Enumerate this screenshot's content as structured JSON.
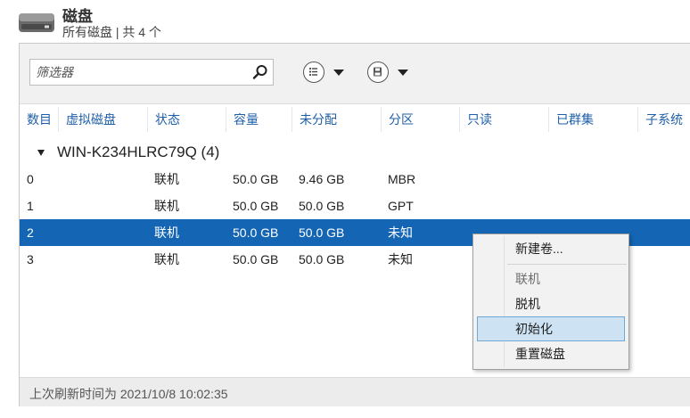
{
  "header": {
    "title": "磁盘",
    "subtitle": "所有磁盘 | 共 4 个"
  },
  "toolbar": {
    "filter_placeholder": "筛选器",
    "icons": [
      "search-icon",
      "list-view-icon",
      "save-icon"
    ]
  },
  "columns": [
    "数目",
    "虚拟磁盘",
    "状态",
    "容量",
    "未分配",
    "分区",
    "只读",
    "已群集",
    "子系统"
  ],
  "group": {
    "label": "WIN-K234HLRC79Q (4)"
  },
  "rows": [
    {
      "number": "0",
      "virtual": "",
      "status": "联机",
      "capacity": "50.0 GB",
      "unallocated": "9.46 GB",
      "partition": "MBR",
      "selected": false
    },
    {
      "number": "1",
      "virtual": "",
      "status": "联机",
      "capacity": "50.0 GB",
      "unallocated": "50.0 GB",
      "partition": "GPT",
      "selected": false
    },
    {
      "number": "2",
      "virtual": "",
      "status": "联机",
      "capacity": "50.0 GB",
      "unallocated": "50.0 GB",
      "partition": "未知",
      "selected": true
    },
    {
      "number": "3",
      "virtual": "",
      "status": "联机",
      "capacity": "50.0 GB",
      "unallocated": "50.0 GB",
      "partition": "未知",
      "selected": false
    }
  ],
  "status_bar": {
    "text": "上次刷新时间为 2021/10/8 10:02:35"
  },
  "context_menu": {
    "items": [
      {
        "label": "新建卷...",
        "enabled": true
      },
      {
        "label": "联机",
        "enabled": false
      },
      {
        "label": "脱机",
        "enabled": true
      },
      {
        "label": "初始化",
        "enabled": true,
        "highlighted": true
      },
      {
        "label": "重置磁盘",
        "enabled": true
      }
    ]
  },
  "colors": {
    "selection": "#1466b4",
    "column_header": "#1f5fa8",
    "menu_highlight": "#cde3f3"
  }
}
